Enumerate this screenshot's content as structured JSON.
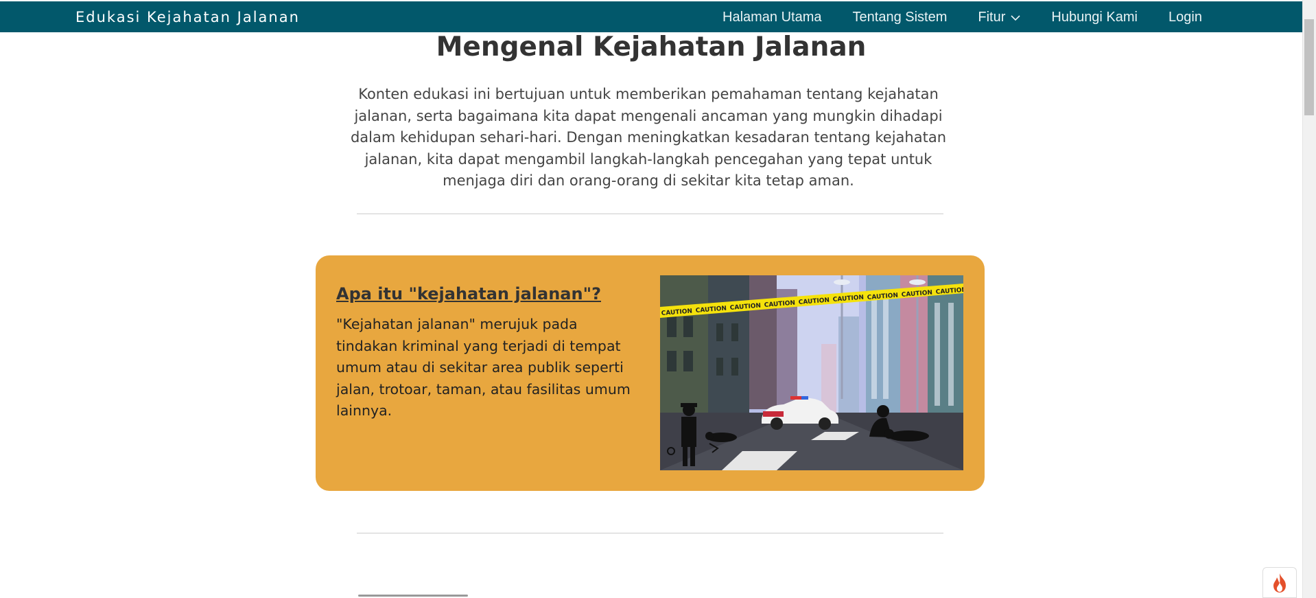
{
  "navbar": {
    "brand": "Edukasi Kejahatan Jalanan",
    "links": [
      {
        "label": "Halaman Utama"
      },
      {
        "label": "Tentang Sistem"
      },
      {
        "label": "Fitur"
      },
      {
        "label": "Hubungi Kami"
      },
      {
        "label": "Login"
      }
    ]
  },
  "main": {
    "title": "Mengenal Kejahatan Jalanan",
    "intro": "Konten edukasi ini bertujuan untuk memberikan pemahaman tentang kejahatan jalanan, serta bagaimana kita dapat mengenali ancaman yang mungkin dihadapi dalam kehidupan sehari-hari. Dengan meningkatkan kesadaran tentang kejahatan jalanan, kita dapat mengambil langkah-langkah pencegahan yang tepat untuk menjaga diri dan orang-orang di sekitar kita tetap aman."
  },
  "card": {
    "title": "Apa itu \"kejahatan jalanan\"?",
    "text": "\"Kejahatan jalanan\" merujuk pada tindakan kriminal yang terjadi di tempat umum atau di sekitar area publik seperti jalan, trotoar, taman, atau fasilitas umum lainnya.",
    "tape_text": "CAUTION"
  },
  "colors": {
    "navbar": "#02586b",
    "card": "#e8a73f",
    "tape": "#f5e20c"
  },
  "icons": {
    "dropdown": "chevron-down-icon",
    "fab": "fire-icon"
  }
}
